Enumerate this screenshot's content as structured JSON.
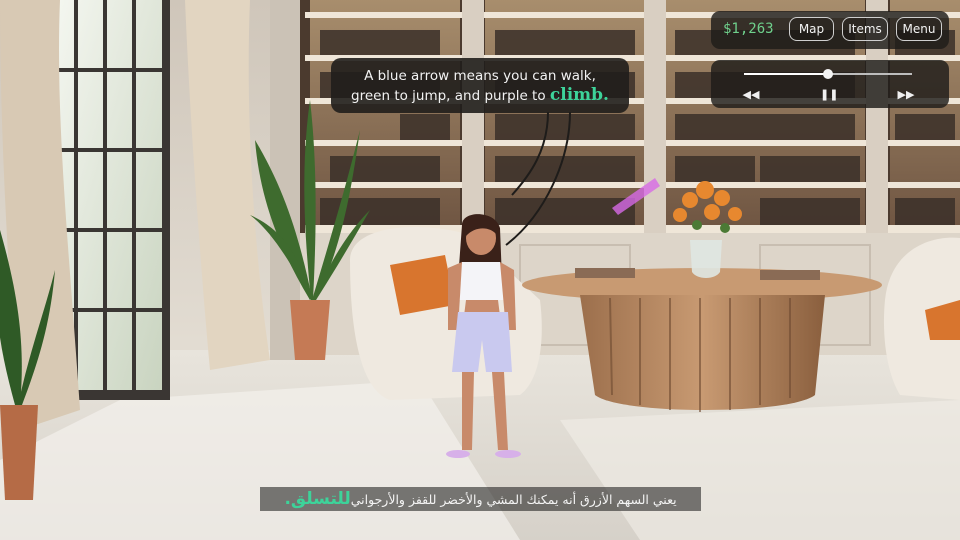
{
  "hud": {
    "money": "$1,263",
    "map_label": "Map",
    "items_label": "Items",
    "menu_label": "Menu"
  },
  "player": {
    "progress": 0.5,
    "rewind_icon": "rewind-icon",
    "pause_icon": "pause-icon",
    "forward_icon": "fast-forward-icon"
  },
  "dialogue": {
    "line1": "A blue arrow means you can walk,",
    "line2_prefix": "green to jump, and purple to ",
    "line2_highlight": "climb."
  },
  "subtitle": {
    "text_before": "يعني السهم الأزرق أنه يمكنك المشي والأخضر للقفز والأرجواني ",
    "highlight": "للتسلق."
  },
  "colors": {
    "accent_green": "#3dd39a",
    "money_green": "#6fd08c",
    "hud_bg": "#1e1c1a"
  }
}
